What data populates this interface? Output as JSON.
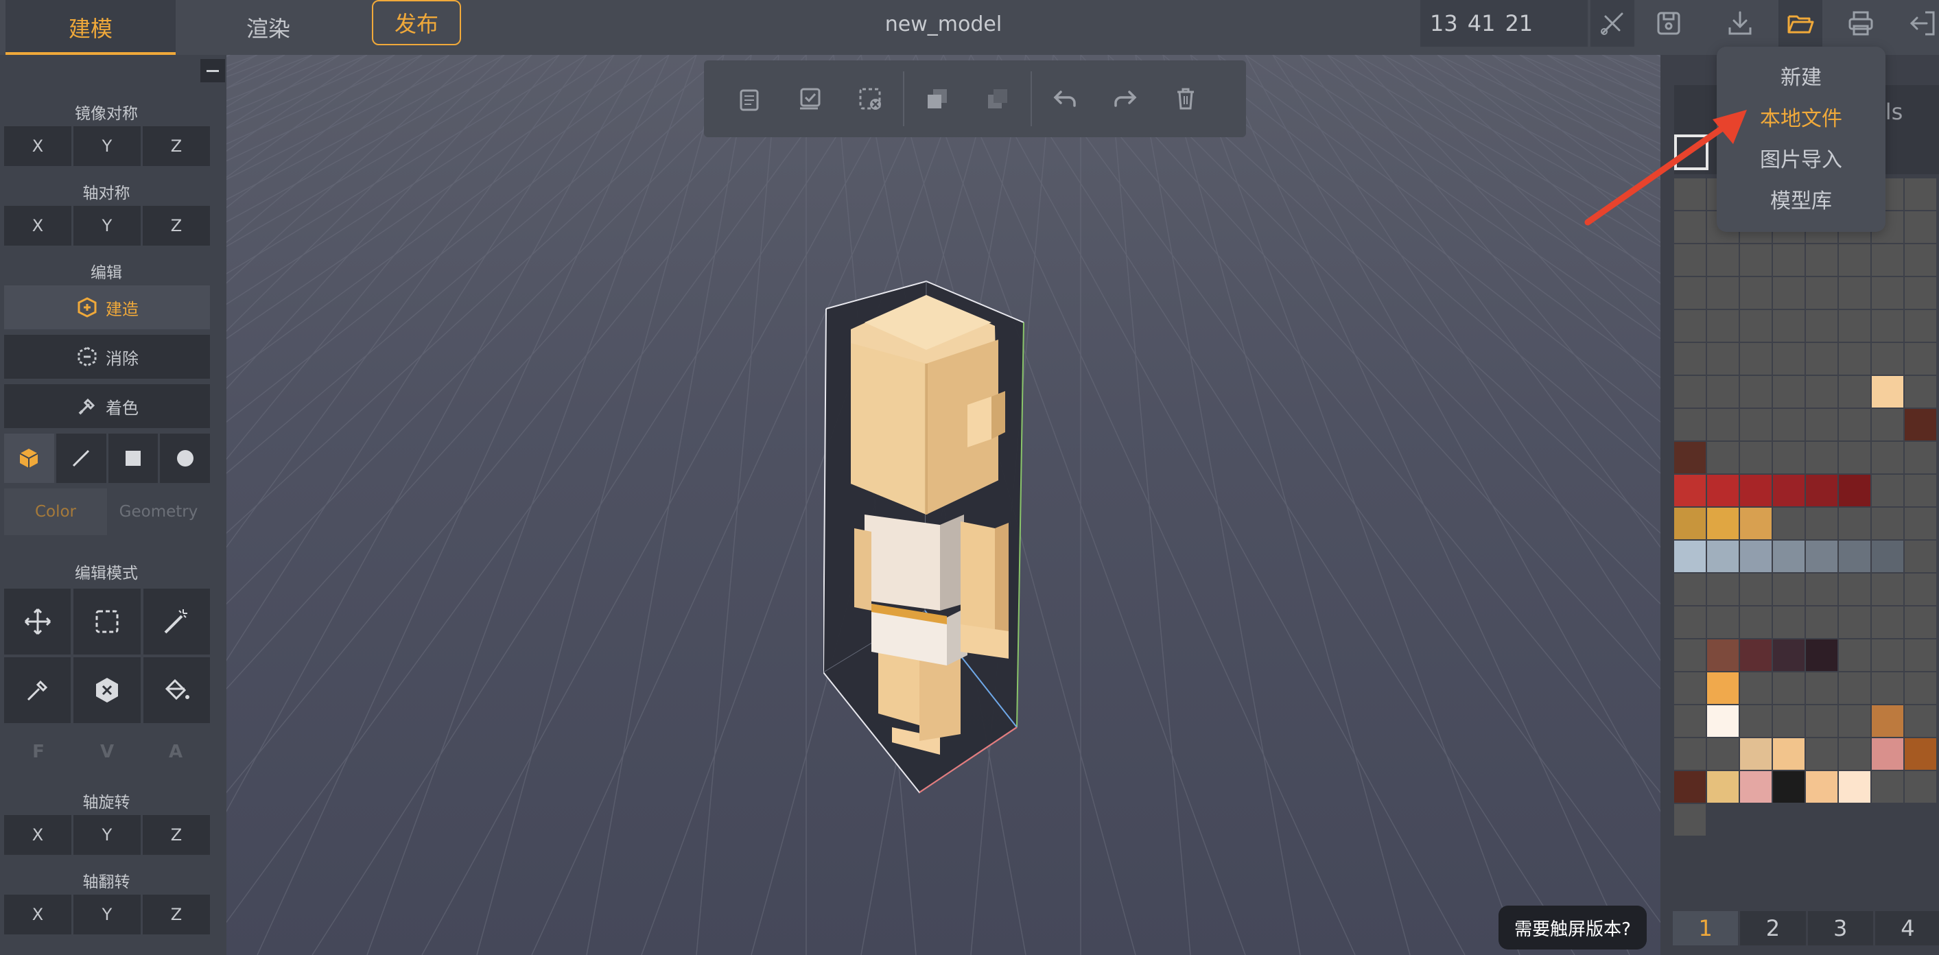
{
  "header": {
    "tabs": [
      {
        "label": "建模",
        "active": true
      },
      {
        "label": "渲染",
        "active": false
      }
    ],
    "publish_label": "发布",
    "title": "new_model",
    "coords": [
      "13",
      "41",
      "21"
    ]
  },
  "sidebar": {
    "mirror_label": "镜像对称",
    "axis_sym_label": "轴对称",
    "edit_label": "编辑",
    "axes": [
      "X",
      "Y",
      "Z"
    ],
    "tools": {
      "build": "建造",
      "erase": "消除",
      "paint": "着色"
    },
    "color_label": "Color",
    "geometry_label": "Geometry",
    "edit_mode_label": "编辑模式",
    "fva": [
      "F",
      "V",
      "A"
    ],
    "rotate_label": "轴旋转",
    "flip_label": "轴翻转"
  },
  "right_panel": {
    "header_partial": "els",
    "pages": [
      "1",
      "2",
      "3",
      "4"
    ],
    "palette": [
      "#545454",
      "#545454",
      "#545454",
      "#545454",
      "#545454",
      "#545454",
      "#545454",
      "#545454",
      "#545454",
      "#545454",
      "#545454",
      "#545454",
      "#545454",
      "#545454",
      "#545454",
      "#545454",
      "#545454",
      "#545454",
      "#545454",
      "#545454",
      "#545454",
      "#545454",
      "#545454",
      "#545454",
      "#545454",
      "#545454",
      "#545454",
      "#545454",
      "#545454",
      "#545454",
      "#545454",
      "#545454",
      "#545454",
      "#545454",
      "#545454",
      "#545454",
      "#545454",
      "#545454",
      "#545454",
      "#545454",
      "#545454",
      "#545454",
      "#545454",
      "#545454",
      "#545454",
      "#545454",
      "#545454",
      "#545454",
      "#545454",
      "#545454",
      "#545454",
      "#545454",
      "#545454",
      "#545454",
      "#f6cf9c",
      "#545454",
      "#545454",
      "#545454",
      "#545454",
      "#545454",
      "#545454",
      "#545454",
      "#545454",
      "#5a2a20",
      "#5a2e24",
      "#545454",
      "#545454",
      "#545454",
      "#545454",
      "#545454",
      "#545454",
      "#545454",
      "#c0322e",
      "#b82b2b",
      "#a82527",
      "#9b2226",
      "#8c1f22",
      "#7c1a1c",
      "#545454",
      "#545454",
      "#c8953c",
      "#e0a642",
      "#d8a050",
      "#545454",
      "#545454",
      "#545454",
      "#545454",
      "#545454",
      "#b0c0cf",
      "#a0afbd",
      "#919ead",
      "#838f9c",
      "#76808c",
      "#69727d",
      "#5d656f",
      "#545454",
      "#545454",
      "#545454",
      "#545454",
      "#545454",
      "#545454",
      "#545454",
      "#545454",
      "#545454",
      "#545454",
      "#545454",
      "#545454",
      "#545454",
      "#545454",
      "#545454",
      "#545454",
      "#545454",
      "#545454",
      "#7d4a3c",
      "#5e2e32",
      "#3e2a34",
      "#2e1e26",
      "#545454",
      "#545454",
      "#545454",
      "#545454",
      "#f0a94c",
      "#545454",
      "#545454",
      "#545454",
      "#545454",
      "#545454",
      "#545454",
      "#545454",
      "#fdf3ea",
      "#545454",
      "#545454",
      "#545454",
      "#545454",
      "#bd7a3e",
      "#545454",
      "#545454",
      "#545454",
      "#e2bf92",
      "#f2c48c",
      "#545454",
      "#545454",
      "#d9908c",
      "#a65a22",
      "#5a2a20",
      "#e6c07c",
      "#e4a7a3",
      "#1c1c1c",
      "#f4c490",
      "#fde4cc",
      "#545454",
      "#545454",
      "#545454"
    ]
  },
  "dropdown": {
    "items": [
      "新建",
      "本地文件",
      "图片导入",
      "模型库"
    ],
    "active_index": 1
  },
  "touch_hint": "需要触屏版本?",
  "colors": {
    "accent": "#f0a93a",
    "arrow": "#e8432c"
  }
}
